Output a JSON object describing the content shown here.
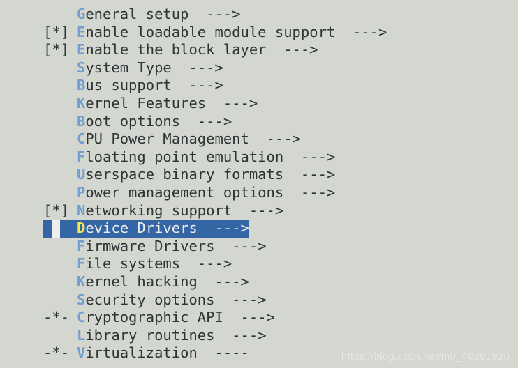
{
  "app": {
    "kind": "terminal-menuconfig",
    "colors": {
      "background": "#d3d7cf",
      "text": "#2e3436",
      "hotkey": "#729fcf",
      "selected_background": "#3465a4",
      "selected_text": "#eeeeec",
      "selected_hotkey": "#fce94f",
      "cursor_block": "#eeeeec",
      "watermark": "#e4e7e0"
    }
  },
  "menu": {
    "selected_index": 12,
    "items": [
      {
        "prefix": "",
        "hotkey": "G",
        "label": "eneral setup",
        "arrow": "--->"
      },
      {
        "prefix": "[*]",
        "hotkey": "E",
        "label": "nable loadable module support",
        "arrow": "--->"
      },
      {
        "prefix": "[*]",
        "hotkey": "E",
        "label": "nable the block layer",
        "arrow": "--->"
      },
      {
        "prefix": "",
        "hotkey": "S",
        "label": "ystem Type",
        "arrow": "--->"
      },
      {
        "prefix": "",
        "hotkey": "B",
        "label": "us support",
        "arrow": "--->"
      },
      {
        "prefix": "",
        "hotkey": "K",
        "label": "ernel Features",
        "arrow": "--->"
      },
      {
        "prefix": "",
        "hotkey": "B",
        "label": "oot options",
        "arrow": "--->"
      },
      {
        "prefix": "",
        "hotkey": "C",
        "label": "PU Power Management",
        "arrow": "--->"
      },
      {
        "prefix": "",
        "hotkey": "F",
        "label": "loating point emulation",
        "arrow": "--->"
      },
      {
        "prefix": "",
        "hotkey": "U",
        "label": "serspace binary formats",
        "arrow": "--->"
      },
      {
        "prefix": "",
        "hotkey": "P",
        "label": "ower management options",
        "arrow": "--->"
      },
      {
        "prefix": "[*]",
        "hotkey": "N",
        "label": "etworking support",
        "arrow": "--->"
      },
      {
        "prefix": "",
        "hotkey": "D",
        "label": "evice Drivers",
        "arrow": "--->"
      },
      {
        "prefix": "",
        "hotkey": "F",
        "label": "irmware Drivers",
        "arrow": "--->"
      },
      {
        "prefix": "",
        "hotkey": "F",
        "label": "ile systems",
        "arrow": "--->"
      },
      {
        "prefix": "",
        "hotkey": "K",
        "label": "ernel hacking",
        "arrow": "--->"
      },
      {
        "prefix": "",
        "hotkey": "S",
        "label": "ecurity options",
        "arrow": "--->"
      },
      {
        "prefix": "-*-",
        "hotkey": "C",
        "label": "ryptographic API",
        "arrow": "--->"
      },
      {
        "prefix": "",
        "hotkey": "L",
        "label": "ibrary routines",
        "arrow": "--->"
      },
      {
        "prefix": "-*-",
        "hotkey": "V",
        "label": "irtualization",
        "arrow": "----"
      }
    ]
  },
  "watermark": {
    "text": "https://blog.csdn.net/m0_46291920"
  }
}
